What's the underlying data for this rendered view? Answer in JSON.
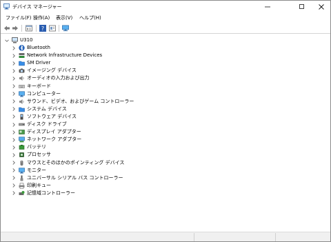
{
  "window": {
    "title": "デバイス マネージャー",
    "controls": {
      "minimize": "—",
      "maximize": "☐",
      "close": "✕"
    }
  },
  "menu": [
    {
      "label": "ファイル(F)"
    },
    {
      "label": "操作(A)"
    },
    {
      "label": "表示(V)"
    },
    {
      "label": "ヘルプ(H)"
    }
  ],
  "toolbar": [
    {
      "icon": "back-arrow-icon"
    },
    {
      "icon": "forward-arrow-icon"
    },
    {
      "icon": "properties-icon"
    },
    {
      "icon": "help-icon"
    },
    {
      "icon": "action-view-icon"
    },
    {
      "icon": "monitor-scan-icon"
    }
  ],
  "tree": {
    "root": {
      "label": "U310",
      "icon": "computer-icon"
    },
    "items": [
      {
        "label": "Bluetooth",
        "icon": "bluetooth-icon"
      },
      {
        "label": "Network Infrastructure Devices",
        "icon": "network-device-icon"
      },
      {
        "label": "SM Driver",
        "icon": "folder-icon"
      },
      {
        "label": "イメージング デバイス",
        "icon": "camera-icon"
      },
      {
        "label": "オーディオの入力および出力",
        "icon": "speaker-icon"
      },
      {
        "label": "キーボード",
        "icon": "keyboard-icon"
      },
      {
        "label": "コンピューター",
        "icon": "monitor-icon"
      },
      {
        "label": "サウンド、ビデオ、およびゲーム コントローラー",
        "icon": "speaker-icon"
      },
      {
        "label": "システム デバイス",
        "icon": "folder-icon"
      },
      {
        "label": "ソフトウェア デバイス",
        "icon": "software-device-icon"
      },
      {
        "label": "ディスク ドライブ",
        "icon": "disk-drive-icon"
      },
      {
        "label": "ディスプレイ アダプター",
        "icon": "display-adapter-icon"
      },
      {
        "label": "ネットワーク アダプター",
        "icon": "network-adapter-icon"
      },
      {
        "label": "バッテリ",
        "icon": "battery-icon"
      },
      {
        "label": "プロセッサ",
        "icon": "processor-icon"
      },
      {
        "label": "マウスとそのほかのポインティング デバイス",
        "icon": "mouse-icon"
      },
      {
        "label": "モニター",
        "icon": "monitor-icon"
      },
      {
        "label": "ユニバーサル シリアル バス コントローラー",
        "icon": "usb-icon"
      },
      {
        "label": "印刷キュー",
        "icon": "printer-icon"
      },
      {
        "label": "記憶域コントローラー",
        "icon": "storage-controller-icon"
      }
    ]
  },
  "colors": {
    "accent_blue": "#2a7fd4",
    "folder_blue": "#3a8ee6",
    "chevron_gray": "#6b6b6b"
  }
}
